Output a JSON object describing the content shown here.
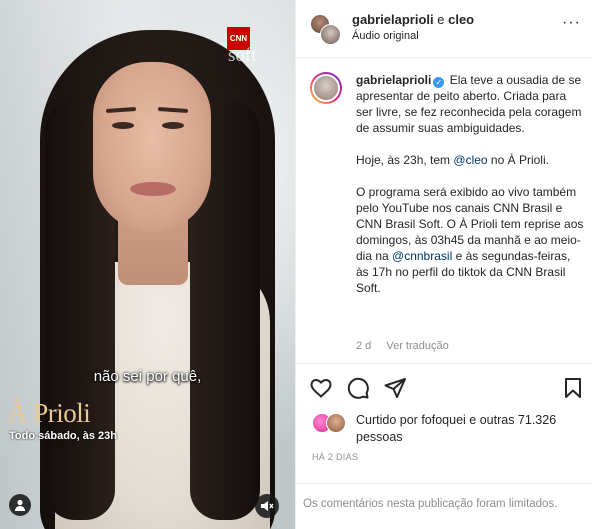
{
  "video": {
    "logo_text": "CNN",
    "channel_wordmark": "soft",
    "subtitle": "não sei por quê,",
    "show_title": "À Prioli",
    "show_schedule": "Todo sábado, às 23h",
    "icons": {
      "tagged_people": "person-icon",
      "mute": "muted-speaker-icon"
    }
  },
  "header": {
    "user1": "gabrielaprioli",
    "connector": " e ",
    "user2": "cleo",
    "audio": "Áudio original",
    "more_icon": "more-horizontal-icon",
    "more_glyph": "···"
  },
  "caption": {
    "username": "gabrielaprioli",
    "verified_glyph": "✓",
    "p1": "Ela teve a ousadia de se apresentar de peito aberto. Criada para ser livre, se fez reconhecida pela coragem de assumir suas ambiguidades.",
    "p2_before": "Hoje, às 23h, tem ",
    "p2_mention": "@cleo",
    "p2_after": " no À Prioli.",
    "p3_before": "O programa será exibido ao vivo também pelo YouTube nos canais CNN Brasil e CNN Brasil Soft. O À Prioli tem reprise aos domingos, às 03h45 da manhã e ao meio-dia na ",
    "p3_mention": "@cnnbrasil",
    "p3_after": " e às segundas-feiras, às 17h no perfil do tiktok da CNN Brasil Soft.",
    "time": "2 d",
    "translate": "Ver tradução"
  },
  "actions": {
    "like": "heart-icon",
    "comment": "comment-icon",
    "share": "send-icon",
    "save": "bookmark-icon"
  },
  "likes": {
    "prefix": "Curtido por ",
    "user": "fofoquei",
    "middle": " e ",
    "others": "outras 71.326 pessoas"
  },
  "posted_ago": "HÁ 2 DIAS",
  "comments_limited": "Os comentários nesta publicação foram limitados.",
  "colors": {
    "accent_blue": "#3897f0",
    "mention": "#00376b",
    "muted_text": "#8e8e8e",
    "cnn_red": "#cc0000"
  }
}
